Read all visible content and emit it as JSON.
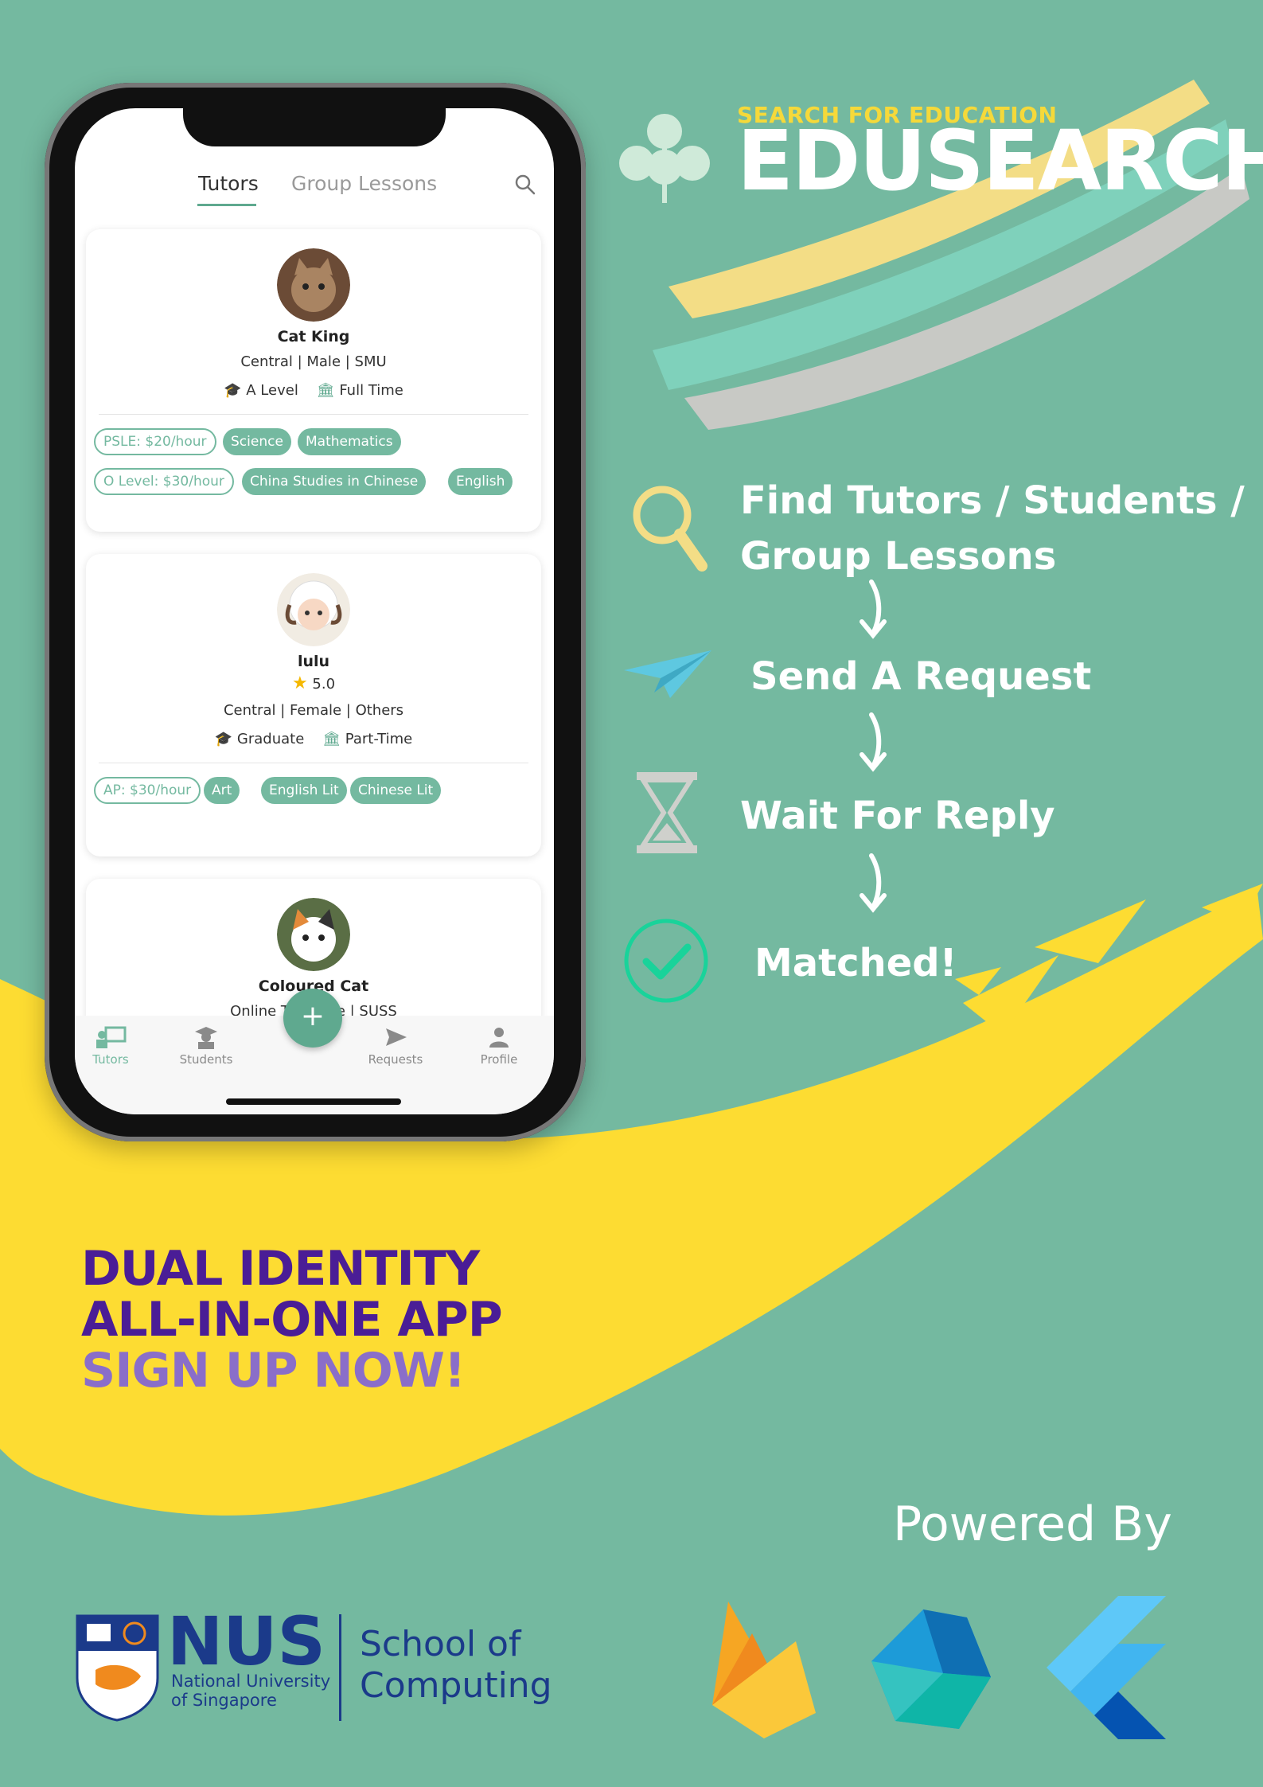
{
  "colors": {
    "background": "#74b9a0",
    "accent": "#5fa98f",
    "yellow": "#fddc32",
    "purple_dark": "#4a1d96",
    "purple_light": "#8a6ec9",
    "nus_blue": "#1b3a8a"
  },
  "brand": {
    "tagline": "SEARCH FOR EDUCATION",
    "name": "EDUSEARCH"
  },
  "steps": [
    {
      "icon": "magnifier-icon",
      "line1": "Find Tutors /  Students /",
      "line2": "Group Lessons"
    },
    {
      "icon": "paper-plane-icon",
      "line1": "Send A Request",
      "line2": ""
    },
    {
      "icon": "hourglass-icon",
      "line1": "Wait For Reply",
      "line2": ""
    },
    {
      "icon": "check-circle-icon",
      "line1": "Matched!",
      "line2": ""
    }
  ],
  "app": {
    "tabs": [
      "Tutors",
      "Group Lessons"
    ],
    "cards": [
      {
        "name": "Cat King",
        "rating": "",
        "location": "Central | Male | SMU",
        "level": "A Level",
        "type": "Full Time",
        "rows": [
          [
            "PSLE: $20/hour",
            "Science",
            "Mathematics"
          ],
          [
            "O Level: $30/hour",
            "China Studies in Chinese",
            "English"
          ]
        ]
      },
      {
        "name": "lulu",
        "rating": "5.0",
        "location": "Central | Female | Others",
        "level": "Graduate",
        "type": "Part-Time",
        "rows": [
          [
            "AP: $30/hour",
            "Art",
            "English Lit",
            "Chinese Lit"
          ]
        ]
      },
      {
        "name": "Coloured Cat",
        "rating": "",
        "location": "Online Tuiti        nale | SUSS",
        "level": "",
        "type": "",
        "rows": []
      }
    ],
    "nav": [
      "Tutors",
      "Students",
      "Requests",
      "Profile"
    ],
    "fab": "+"
  },
  "slogan": {
    "line1": "DUAL IDENTITY",
    "line2": "ALL-IN-ONE APP",
    "line3": "SIGN UP NOW!"
  },
  "footer": {
    "powered": "Powered By",
    "nus": "NUS",
    "nus_sub1": "National University",
    "nus_sub2": "of Singapore",
    "soc1": "School of",
    "soc2": "Computing",
    "logos": [
      "firebase-icon",
      "dart-icon",
      "flutter-icon"
    ]
  }
}
